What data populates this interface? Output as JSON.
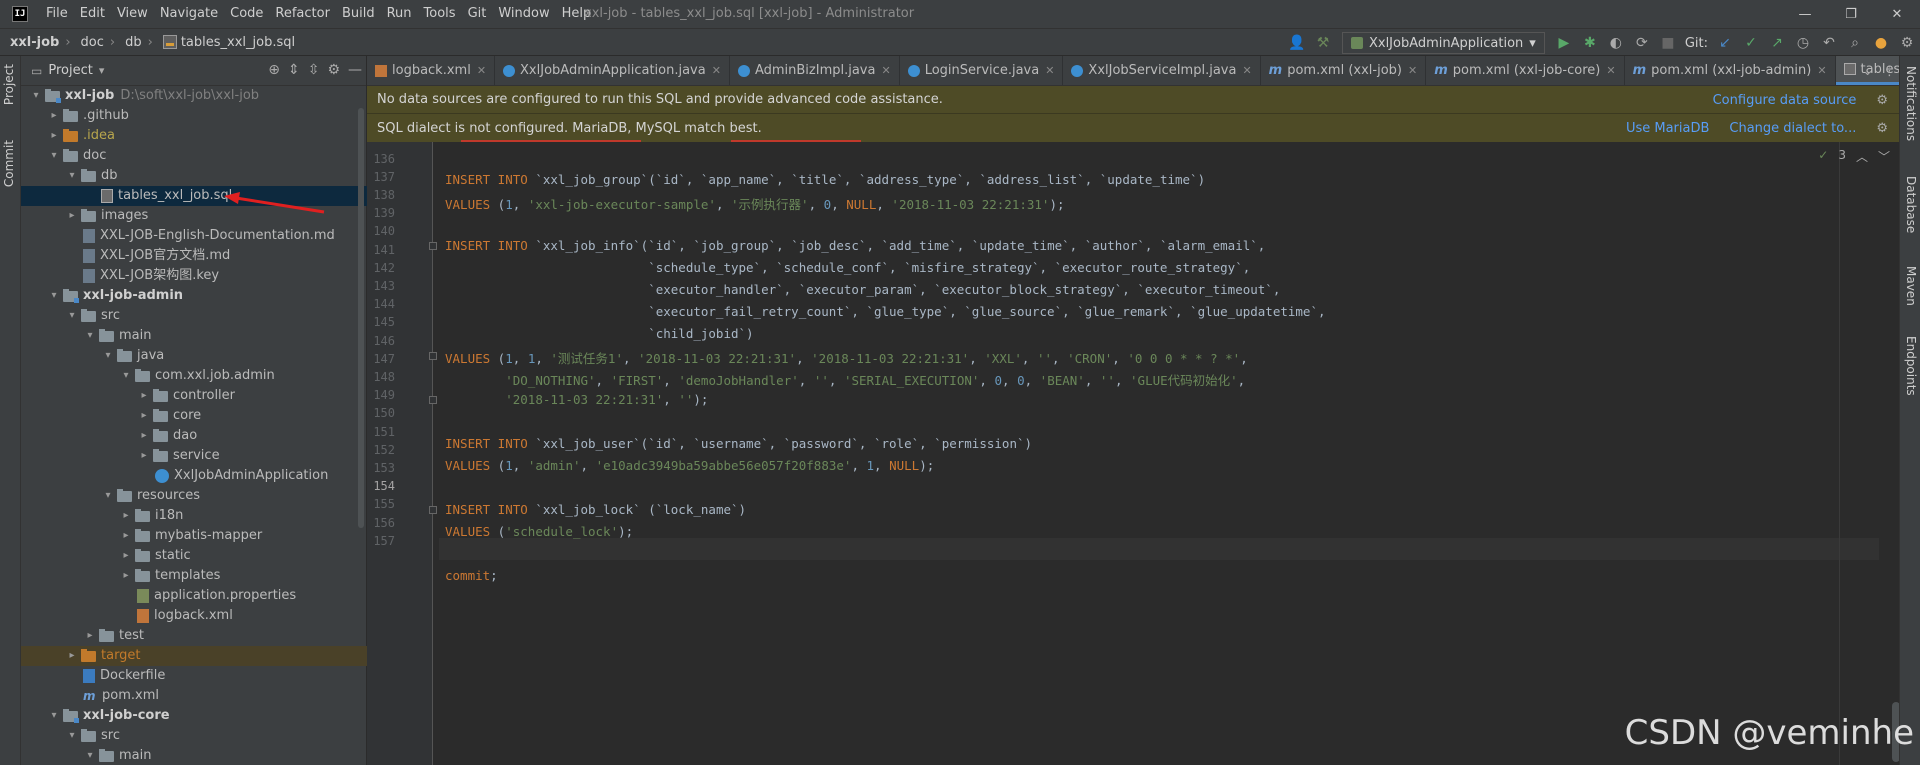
{
  "titlebar": {
    "menu": [
      "File",
      "Edit",
      "View",
      "Navigate",
      "Code",
      "Refactor",
      "Build",
      "Run",
      "Tools",
      "Git",
      "Window",
      "Help"
    ],
    "window_title": "xxl-job - tables_xxl_job.sql [xxl-job] - Administrator",
    "logo": "IJ"
  },
  "navbar": {
    "crumbs": [
      "xxl-job",
      "doc",
      "db",
      "tables_xxl_job.sql"
    ],
    "run_config": "XxlJobAdminApplication",
    "git_label": "Git:"
  },
  "left_strip": {
    "project_label": "Project",
    "commit_label": "Commit"
  },
  "project_panel": {
    "title": "Project",
    "tree": [
      {
        "depth": 0,
        "chev": "v",
        "icon": "folder-module",
        "label": "xxl-job",
        "path": "D:\\soft\\xxl-job\\xxl-job",
        "style": "bold"
      },
      {
        "depth": 1,
        "chev": ">",
        "icon": "folder",
        "label": ".github"
      },
      {
        "depth": 1,
        "chev": ">",
        "icon": "folder-orange",
        "label": ".idea",
        "style": "yellow"
      },
      {
        "depth": 1,
        "chev": "v",
        "icon": "folder",
        "label": "doc"
      },
      {
        "depth": 2,
        "chev": "v",
        "icon": "folder",
        "label": "db"
      },
      {
        "depth": 3,
        "chev": "",
        "icon": "sql",
        "label": "tables_xxl_job.sql",
        "selected": true
      },
      {
        "depth": 2,
        "chev": ">",
        "icon": "folder",
        "label": "images"
      },
      {
        "depth": 2,
        "chev": "",
        "icon": "md",
        "label": "XXL-JOB-English-Documentation.md"
      },
      {
        "depth": 2,
        "chev": "",
        "icon": "md",
        "label": "XXL-JOB官方文档.md"
      },
      {
        "depth": 2,
        "chev": "",
        "icon": "md",
        "label": "XXL-JOB架构图.key"
      },
      {
        "depth": 1,
        "chev": "v",
        "icon": "folder-module",
        "label": "xxl-job-admin",
        "style": "bold"
      },
      {
        "depth": 2,
        "chev": "v",
        "icon": "folder",
        "label": "src"
      },
      {
        "depth": 3,
        "chev": "v",
        "icon": "folder",
        "label": "main"
      },
      {
        "depth": 4,
        "chev": "v",
        "icon": "folder",
        "label": "java"
      },
      {
        "depth": 5,
        "chev": "v",
        "icon": "folder",
        "label": "com.xxl.job.admin"
      },
      {
        "depth": 6,
        "chev": ">",
        "icon": "folder",
        "label": "controller"
      },
      {
        "depth": 6,
        "chev": ">",
        "icon": "folder",
        "label": "core"
      },
      {
        "depth": 6,
        "chev": ">",
        "icon": "folder",
        "label": "dao"
      },
      {
        "depth": 6,
        "chev": ">",
        "icon": "folder",
        "label": "service"
      },
      {
        "depth": 6,
        "chev": "",
        "icon": "class",
        "label": "XxlJobAdminApplication"
      },
      {
        "depth": 4,
        "chev": "v",
        "icon": "folder",
        "label": "resources"
      },
      {
        "depth": 5,
        "chev": ">",
        "icon": "folder",
        "label": "i18n"
      },
      {
        "depth": 5,
        "chev": ">",
        "icon": "folder",
        "label": "mybatis-mapper"
      },
      {
        "depth": 5,
        "chev": ">",
        "icon": "folder",
        "label": "static"
      },
      {
        "depth": 5,
        "chev": ">",
        "icon": "folder",
        "label": "templates"
      },
      {
        "depth": 5,
        "chev": "",
        "icon": "prop",
        "label": "application.properties"
      },
      {
        "depth": 5,
        "chev": "",
        "icon": "xml",
        "label": "logback.xml"
      },
      {
        "depth": 3,
        "chev": ">",
        "icon": "folder",
        "label": "test"
      },
      {
        "depth": 2,
        "chev": ">",
        "icon": "folder-orange",
        "label": "target",
        "style": "orange",
        "excluded": true
      },
      {
        "depth": 2,
        "chev": "",
        "icon": "docker",
        "label": "Dockerfile"
      },
      {
        "depth": 2,
        "chev": "",
        "icon": "pom",
        "label": "pom.xml"
      },
      {
        "depth": 1,
        "chev": "v",
        "icon": "folder-module",
        "label": "xxl-job-core",
        "style": "bold"
      },
      {
        "depth": 2,
        "chev": "v",
        "icon": "folder",
        "label": "src"
      },
      {
        "depth": 3,
        "chev": "v",
        "icon": "folder",
        "label": "main"
      }
    ]
  },
  "tabs": [
    {
      "label": "logback.xml",
      "icon": "xml"
    },
    {
      "label": "XxlJobAdminApplication.java",
      "icon": "cls"
    },
    {
      "label": "AdminBizImpl.java",
      "icon": "cls"
    },
    {
      "label": "LoginService.java",
      "icon": "cls"
    },
    {
      "label": "XxlJobServiceImpl.java",
      "icon": "cls"
    },
    {
      "label": "pom.xml (xxl-job)",
      "icon": "m"
    },
    {
      "label": "pom.xml (xxl-job-core)",
      "icon": "m"
    },
    {
      "label": "pom.xml (xxl-job-admin)",
      "icon": "m"
    },
    {
      "label": "tables_xxl_job.sql",
      "icon": "sqlf",
      "active": true
    }
  ],
  "banners": {
    "datasource_msg": "No data sources are configured to run this SQL and provide advanced code assistance.",
    "datasource_action": "Configure data source",
    "dialect_msg": "SQL dialect is not configured. MariaDB, MySQL match best.",
    "dialect_action1": "Use MariaDB",
    "dialect_action2": "Change dialect to..."
  },
  "inspection": {
    "count": "3"
  },
  "code": {
    "line_numbers": [
      "136",
      "137",
      "138",
      "139",
      "140",
      "141",
      "142",
      "143",
      "144",
      "145",
      "146",
      "147",
      "148",
      "149",
      "150",
      "151",
      "152",
      "153",
      "154",
      "155",
      "156",
      "157"
    ],
    "current_line": "154"
  },
  "right_strip": [
    "Notifications",
    "Database",
    "Maven",
    "Endpoints"
  ],
  "watermark": "CSDN @veminhe"
}
